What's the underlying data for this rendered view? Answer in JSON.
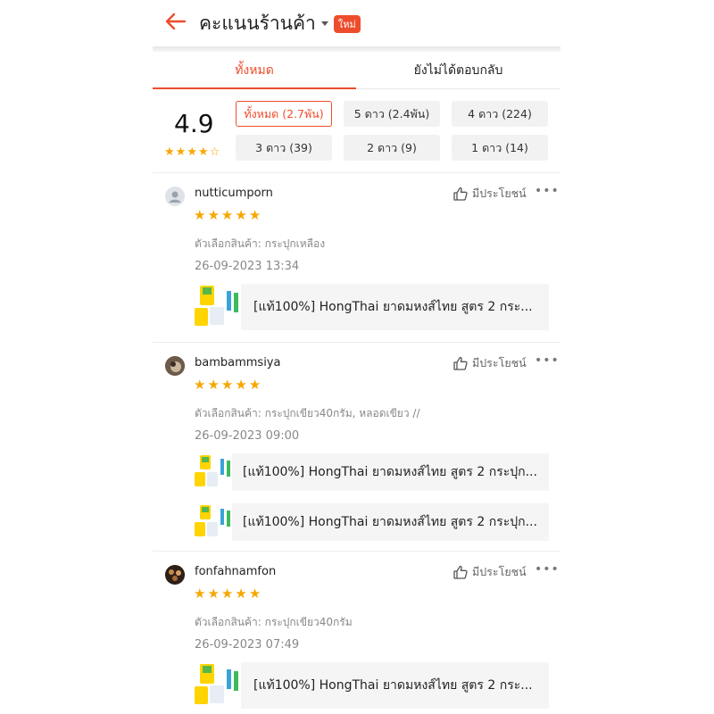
{
  "header": {
    "title": "คะแนนร้านค้า",
    "badge": "ใหม่"
  },
  "tabs": [
    {
      "label": "ทั้งหมด",
      "active": true
    },
    {
      "label": "ยังไม่ได้ตอบกลับ",
      "active": false
    }
  ],
  "summary": {
    "score": "4.9",
    "stars_filled": 4,
    "stars_total": 5,
    "filters": [
      {
        "label": "ทั้งหมด (2.7พัน)",
        "active": true
      },
      {
        "label": "5 ดาว (2.4พัน)",
        "active": false
      },
      {
        "label": "4 ดาว (224)",
        "active": false
      },
      {
        "label": "3 ดาว (39)",
        "active": false
      },
      {
        "label": "2 ดาว (9)",
        "active": false
      },
      {
        "label": "1 ดาว (14)",
        "active": false
      }
    ]
  },
  "reviews": [
    {
      "username": "nutticumporn",
      "helpful": "มีประโยชน์",
      "rating": 5,
      "variant": "ตัวเลือกสินค้า: กระปุกเหลือง",
      "date": "26-09-2023 13:34",
      "products": [
        "[แท้100%] HongThai ยาดมหงส์ไทย สูตร 2 กระ..."
      ]
    },
    {
      "username": "bambammsiya",
      "helpful": "มีประโยชน์",
      "rating": 5,
      "variant": "ตัวเลือกสินค้า: กระปุกเขียว40กรัม, หลอดเขียว //",
      "date": "26-09-2023 09:00",
      "products": [
        "[แท้100%] HongThai ยาดมหงส์ไทย สูตร 2 กระปุก...",
        "[แท้100%] HongThai ยาดมหงส์ไทย สูตร 2 กระปุก..."
      ]
    },
    {
      "username": "fonfahnamfon",
      "helpful": "มีประโยชน์",
      "rating": 5,
      "variant": "ตัวเลือกสินค้า: กระปุกเขียว40กรัม",
      "date": "26-09-2023 07:49",
      "products": [
        "[แท้100%] HongThai ยาดมหงส์ไทย สูตร 2 กระ..."
      ]
    }
  ],
  "colors": {
    "accent": "#ee4d2d",
    "star": "#f6a700"
  }
}
